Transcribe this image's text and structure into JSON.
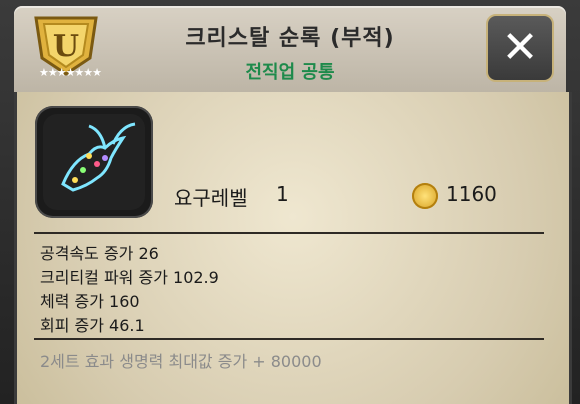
{
  "header": {
    "title": "크리스탈 순록 (부적)",
    "subtitle": "전직업 공통"
  },
  "badge": {
    "letter": "U",
    "stars": "★★★★★★★"
  },
  "close_label": "✕",
  "item": {
    "icon": "crystal-reindeer-icon",
    "req_label": "요구레벨",
    "req_value": "1",
    "gold": "1160"
  },
  "stats": [
    "공격속도 증가 26",
    "크리티컬 파워 증가 102.9",
    "체력 증가 160",
    "회피 증가 46.1"
  ],
  "set_bonus": "2세트 효과   생명력 최대값 증가 + 80000",
  "colors": {
    "subtitle": "#1e8a4b",
    "set_text": "#8b8b8b"
  }
}
